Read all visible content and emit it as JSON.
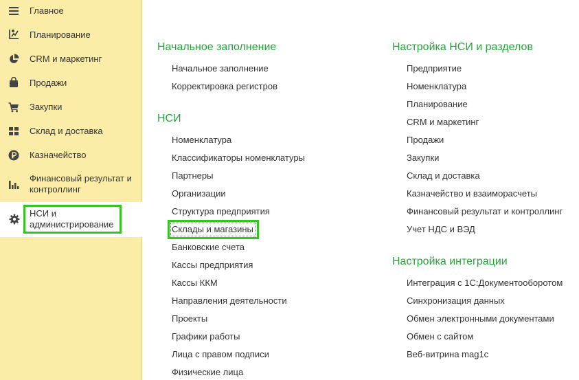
{
  "sidebar": {
    "items": [
      {
        "label": "Главное",
        "icon": "menu-lines-icon"
      },
      {
        "label": "Планирование",
        "icon": "planning-icon"
      },
      {
        "label": "CRM и маркетинг",
        "icon": "pie-chart-icon"
      },
      {
        "label": "Продажи",
        "icon": "shopping-bag-icon"
      },
      {
        "label": "Закупки",
        "icon": "cart-icon"
      },
      {
        "label": "Склад и доставка",
        "icon": "warehouse-grid-icon"
      },
      {
        "label": "Казначейство",
        "icon": "ruble-coin-icon"
      },
      {
        "label": "Финансовый результат и контроллинг",
        "icon": "bar-chart-icon"
      },
      {
        "label": "НСИ и администрирование",
        "icon": "gear-icon"
      }
    ]
  },
  "left_column": {
    "sections": [
      {
        "title": "Начальное заполнение",
        "links": [
          "Начальное заполнение",
          "Корректировка регистров"
        ]
      },
      {
        "title": "НСИ",
        "links": [
          "Номенклатура",
          "Классификаторы номенклатуры",
          "Партнеры",
          "Организации",
          "Структура предприятия",
          "Склады и магазины",
          "Банковские счета",
          "Кассы предприятия",
          "Кассы ККМ",
          "Направления деятельности",
          "Проекты",
          "Графики работы",
          "Лица с правом подписи",
          "Физические лица"
        ]
      }
    ]
  },
  "right_column": {
    "sections": [
      {
        "title": "Настройка НСИ и разделов",
        "links": [
          "Предприятие",
          "Номенклатура",
          "Планирование",
          "CRM и маркетинг",
          "Продажи",
          "Закупки",
          "Склад и доставка",
          "Казначейство и взаиморасчеты",
          "Финансовый результат и контроллинг",
          "Учет НДС и ВЭД"
        ]
      },
      {
        "title": "Настройка интеграции",
        "links": [
          "Интеграция с 1С:Документооборотом",
          "Синхронизация данных",
          "Обмен электронными документами",
          "Обмен с сайтом",
          "Веб-витрина mag1c"
        ]
      }
    ]
  },
  "colors": {
    "sidebar_bg": "#fbeda8",
    "section_title": "#27a33a",
    "highlight": "#34c520"
  }
}
